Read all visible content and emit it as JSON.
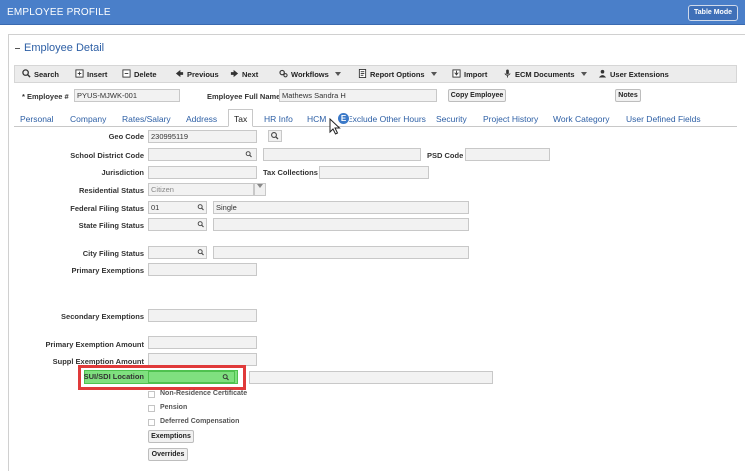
{
  "window": {
    "title": "EMPLOYEE PROFILE",
    "table_mode_label": "Table Mode"
  },
  "section": {
    "title": "Employee Detail"
  },
  "toolbar": {
    "search": "Search",
    "insert": "Insert",
    "delete": "Delete",
    "previous": "Previous",
    "next": "Next",
    "workflows": "Workflows",
    "report_options": "Report Options",
    "import": "Import",
    "ecm_documents": "ECM Documents",
    "user_extensions": "User Extensions"
  },
  "header": {
    "employee_label": "* Employee #",
    "employee_value": "PYUS-MJWK-001",
    "full_name_label": "Employee Full Name",
    "full_name_value": "Mathews Sandra H",
    "copy_employee": "Copy Employee",
    "notes": "Notes"
  },
  "tabs": [
    "Personal",
    "Company",
    "Rates/Salary",
    "Address",
    "Tax",
    "HR Info",
    "HCM",
    "Exclude Other Hours",
    "Security",
    "Project History",
    "Work Category",
    "User Defined Fields"
  ],
  "active_tab": "Tax",
  "tab_bubble_letter": "E",
  "form": {
    "geo_code_label": "Geo Code",
    "geo_code_value": "230995119",
    "school_district_label": "School District Code",
    "psd_code_label": "PSD Code",
    "jurisdiction_label": "Jurisdiction",
    "tax_collections_label": "Tax Collections",
    "residential_status_label": "Residential Status",
    "residential_status_value": "Citizen",
    "federal_filing_label": "Federal Filing Status",
    "federal_filing_value": "01",
    "federal_filing_desc": "Single",
    "state_filing_label": "State Filing Status",
    "city_filing_label": "City Filing Status",
    "primary_exemptions_label": "Primary Exemptions",
    "secondary_exemptions_label": "Secondary Exemptions",
    "primary_exemption_amount_label": "Primary Exemption Amount",
    "suppl_exemption_amount_label": "Suppl Exemption Amount",
    "sui_sdi_label": "SUI/SDI Location"
  },
  "checkboxes": {
    "non_residence": "Non-Residence Certificate",
    "pension": "Pension",
    "deferred_comp": "Deferred Compensation"
  },
  "buttons": {
    "exemptions": "Exemptions",
    "overrides": "Overrides"
  },
  "colors": {
    "header_blue": "#4a7fc9",
    "link_blue": "#2d5fa5",
    "highlight_red": "#e03a3a",
    "highlight_green": "#7fe07f"
  }
}
